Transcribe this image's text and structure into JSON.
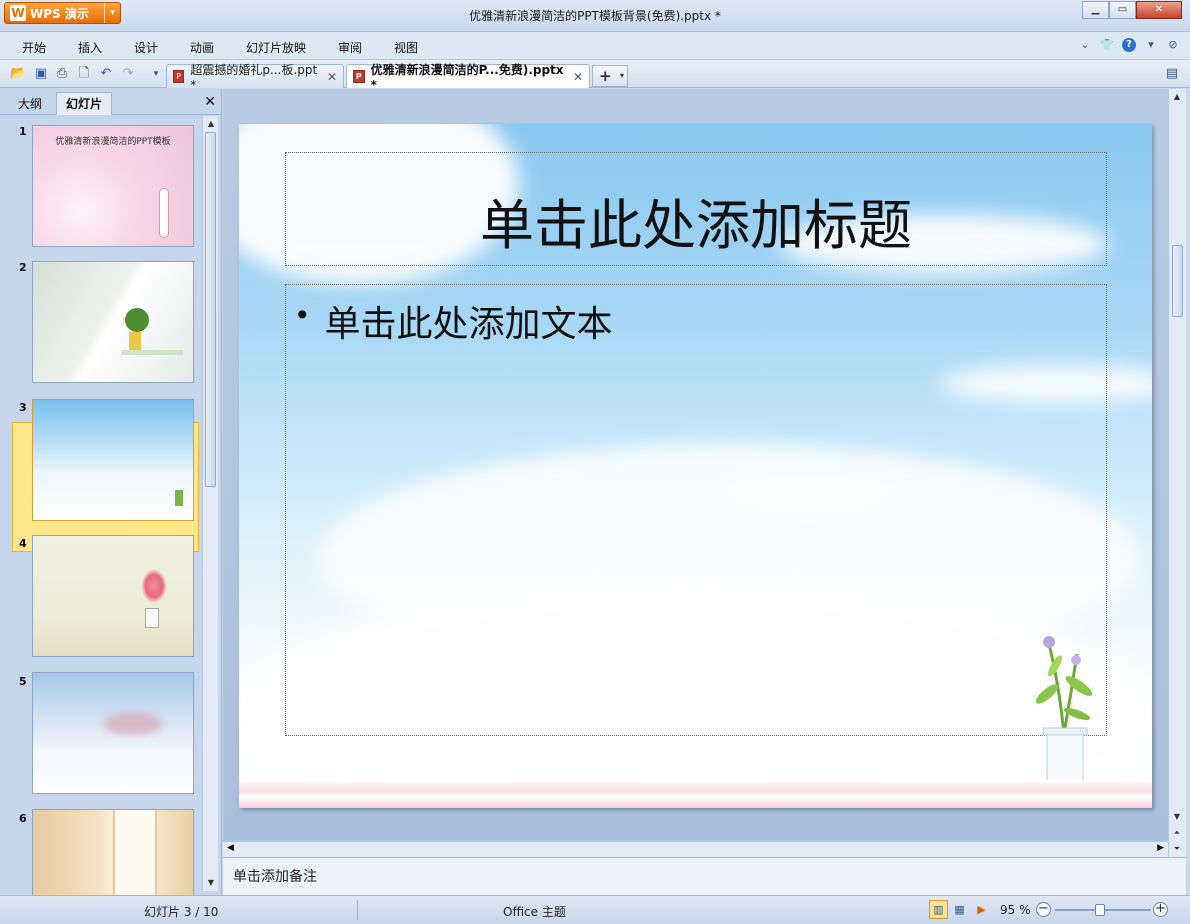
{
  "app": {
    "menu_button_label": "WPS 演示",
    "window_title": "优雅清新浪漫简洁的PPT模板背景(免费).pptx *"
  },
  "menu": {
    "items": [
      "开始",
      "插入",
      "设计",
      "动画",
      "幻灯片放映",
      "审阅",
      "视图"
    ]
  },
  "tabs": [
    {
      "label": "超震撼的婚礼p...板.ppt *",
      "active": false
    },
    {
      "label": "优雅清新浪漫简洁的P...免费).pptx *",
      "active": true
    }
  ],
  "left_pane": {
    "tab_outline": "大纲",
    "tab_slides": "幻灯片",
    "selected_slide": 3,
    "slides": [
      {
        "number": "1",
        "caption": "优雅清新浪漫简洁的PPT模板"
      },
      {
        "number": "2",
        "caption": ""
      },
      {
        "number": "3",
        "caption": ""
      },
      {
        "number": "4",
        "caption": ""
      },
      {
        "number": "5",
        "caption": ""
      },
      {
        "number": "6",
        "caption": ""
      }
    ]
  },
  "slide": {
    "title_placeholder": "单击此处添加标题",
    "body_placeholder": "单击此处添加文本"
  },
  "notes": {
    "placeholder": "单击添加备注"
  },
  "status": {
    "slide_counter": "幻灯片 3 / 10",
    "theme": "Office 主题",
    "zoom": "95 %"
  },
  "colors": {
    "accent_orange": "#e46d05",
    "chrome_blue": "#c5d5ea",
    "selection_yellow": "#ffe68a"
  }
}
